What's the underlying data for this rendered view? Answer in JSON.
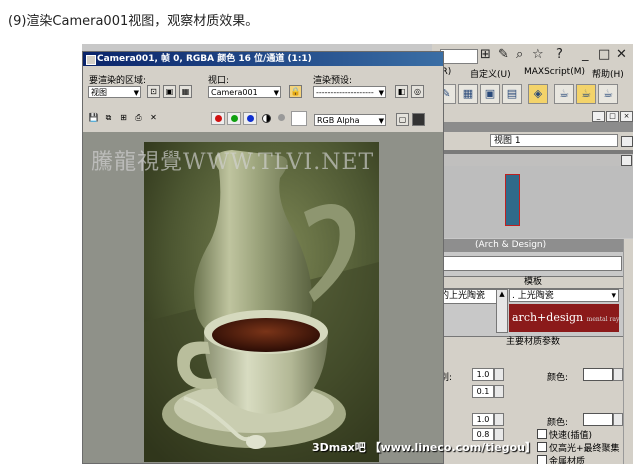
{
  "caption": "(9)渲染Camera001视图，观察材质效果。",
  "max_ui": {
    "menu": [
      "(R)",
      "自定义(U)",
      "MAXScript(M)",
      "帮助(H)"
    ],
    "viewport_select": "视图 1",
    "material_title": "(Arch & Design)",
    "templates_header": "模板",
    "template_item": "的上光陶瓷",
    "template_dropdown": ". 上光陶瓷",
    "arch_logo": "arch+design",
    "arch_logo_sub": "mental ray",
    "main_params_header": "主要材质参数",
    "diffuse_level_label": "别:",
    "diffuse_level": "1.0",
    "roughness": "0.1",
    "color_label": "颜色:",
    "refl_value": "1.0",
    "refl_gloss": "0.8",
    "refl_color_label": "颜色:",
    "fast_label": "快速(插值)",
    "highlights_label": "仅高光+最终聚集",
    "metal_label": "金属材质"
  },
  "render_window": {
    "title": "Camera001, 帧 0, RGBA 颜色 16 位/通道 (1:1)",
    "area_label": "要渲染的区域:",
    "area_value": "视图",
    "viewport_label": "视口:",
    "viewport_value": "Camera001",
    "preset_label": "渲染预设:",
    "preset_value": "--------------------",
    "channel_value": "RGB Alpha",
    "watermark": "騰龍視覺WWW.TLVI.NET"
  },
  "bottom_watermark": "3Dmax吧 【www.lineco.com/tiegou】"
}
